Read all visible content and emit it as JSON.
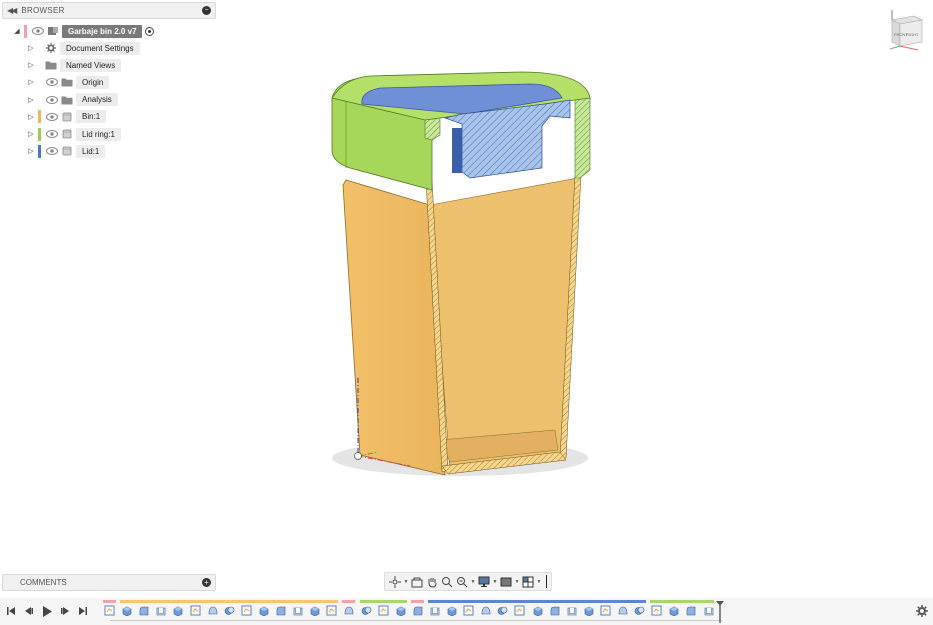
{
  "browser": {
    "title": "BROWSER",
    "root": {
      "label": "Garbaje bin 2.0 v7"
    },
    "items": [
      {
        "label": "Document Settings",
        "icon": "gear-icon",
        "eye": false,
        "color": ""
      },
      {
        "label": "Named Views",
        "icon": "folder-icon",
        "eye": false,
        "color": ""
      },
      {
        "label": "Origin",
        "icon": "folder-icon",
        "eye": true,
        "color": ""
      },
      {
        "label": "Analysis",
        "icon": "folder-icon",
        "eye": true,
        "color": ""
      },
      {
        "label": "Bin:1",
        "icon": "component-icon",
        "eye": true,
        "color": "#f0b75a"
      },
      {
        "label": "Lid ring:1",
        "icon": "component-icon",
        "eye": true,
        "color": "#9ccd4f"
      },
      {
        "label": "Lid:1",
        "icon": "component-icon",
        "eye": true,
        "color": "#4a78c8"
      }
    ]
  },
  "comments": {
    "title": "COMMENTS"
  },
  "viewcube": {
    "front": "FRONT",
    "right": "RIGHT"
  },
  "colors": {
    "bin": "#f5c56a",
    "lid_ring": "#a6d65a",
    "lid": "#6f8fd6",
    "timeline_orange": "#f7c66b",
    "timeline_pink": "#f2a0aa",
    "timeline_green": "#a8d66a",
    "timeline_blue": "#5b86d0"
  },
  "timeline": {
    "segments": [
      {
        "color": "#f2a0aa",
        "count": 1
      },
      {
        "color": "#f7c66b",
        "count": 13
      },
      {
        "color": "#f2a0aa",
        "count": 1
      },
      {
        "color": "#a8d66a",
        "count": 3
      },
      {
        "color": "#f2a0aa",
        "count": 1
      },
      {
        "color": "#5b86d0",
        "count": 13
      },
      {
        "color": "#a8d66a",
        "count": 4
      }
    ]
  }
}
